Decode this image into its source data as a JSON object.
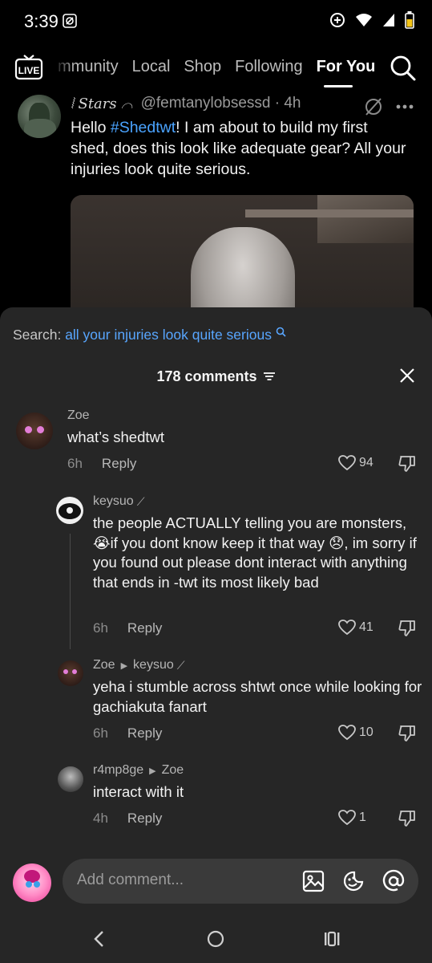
{
  "status_bar": {
    "time": "3:39"
  },
  "top_nav": {
    "tabs": [
      "mmunity",
      "Local",
      "Shop",
      "Following",
      "For You"
    ],
    "active_tab": "For You"
  },
  "post": {
    "author_name": "Stars",
    "author_handle": "@femtanylobsessd",
    "time_ago": "4h",
    "text_before": "Hello ",
    "hashtag": "#Shedtwt",
    "text_after": "! I am about to build my first shed, does this look like adequate gear? All your injuries look quite serious."
  },
  "comments_sheet": {
    "search_label": "Search:",
    "search_query": "all your injuries look quite serious",
    "count_label": "178 comments",
    "reply_label": "Reply",
    "comments": [
      {
        "name": "Zoe",
        "reply_to": "",
        "text": "what’s shedtwt",
        "time": "6h",
        "likes": "94"
      },
      {
        "name": "keysuo",
        "reply_to": "",
        "text": "the people ACTUALLY telling you are monsters,😭if you dont know keep it that way 😞, im sorry if you found out please dont interact with anything that ends in -twt its most likely bad",
        "time": "6h",
        "likes": "41"
      },
      {
        "name": "Zoe",
        "reply_to": "keysuo",
        "text": "yeha i stumble across shtwt once while looking for gachiakuta fanart",
        "time": "6h",
        "likes": "10"
      },
      {
        "name": "r4mp8ge",
        "reply_to": "Zoe",
        "text": "interact with it",
        "time": "4h",
        "likes": "1"
      }
    ]
  },
  "input": {
    "placeholder": "Add comment..."
  },
  "colors": {
    "link": "#58a6ff",
    "sheet_bg": "#262626",
    "hashtag": "#4aa3ff"
  }
}
